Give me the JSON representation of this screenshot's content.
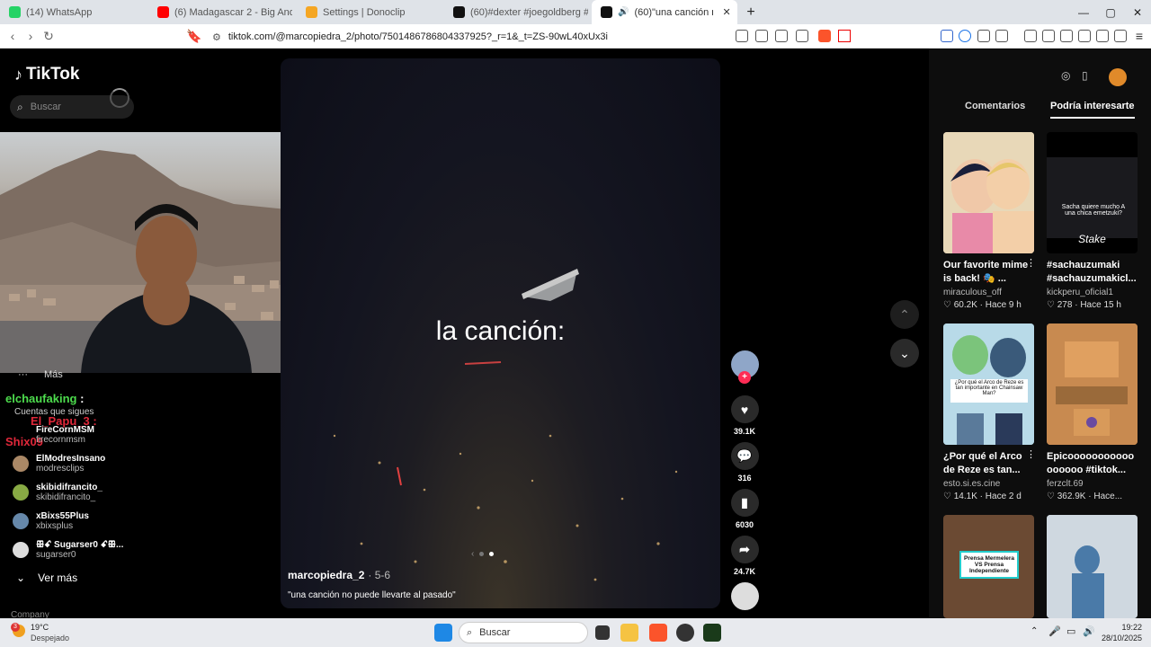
{
  "browser": {
    "tabs": [
      {
        "label": "(14) WhatsApp",
        "color": "#25d366"
      },
      {
        "label": "(6) Madagascar 2 - Big And Chunky",
        "color": "#ff0000"
      },
      {
        "label": "Settings | Donoclip",
        "color": "#f5a623"
      },
      {
        "label": "(60)#dexter #joegoldberg #paratiiii",
        "color": "#111111"
      },
      {
        "label": "(60)\"una canción no puede lle",
        "color": "#111111"
      }
    ],
    "url": "tiktok.com/@marcopiedra_2/photo/7501486786804337925?_r=1&_t=ZS-90wL40xUx3i"
  },
  "sidebar": {
    "logo": "TikTok",
    "search_placeholder": "Buscar",
    "more_label": "Más",
    "following_header": "Cuentas que sigues",
    "accounts": [
      {
        "name": "FireCornMSM",
        "handle": "firecornmsm",
        "color": "#c44"
      },
      {
        "name": "ElModresInsano",
        "handle": "modresclips",
        "color": "#aa8866"
      },
      {
        "name": "skibidifrancito_",
        "handle": "skibidifrancito_",
        "color": "#8a4"
      },
      {
        "name": "xBixs55Plus",
        "handle": "xbixsplus",
        "color": "#68a"
      },
      {
        "name": "ꕥꗃ Sugarser0 ꗃꕥ...",
        "handle": "sugarser0",
        "color": "#ddd"
      }
    ],
    "see_more": "Ver más",
    "company": "Company"
  },
  "chat_overlay": {
    "line1_user": "elchaufaking",
    "line1_sep": ":",
    "line2_user": "El_Papu_3",
    "line2_sep": ":",
    "line3_user": "Shix09"
  },
  "video": {
    "caption": "la canción:",
    "author": "marcopiedra_2",
    "date": "· 5-6",
    "description": "\"una canción no puede llevarte al pasado\""
  },
  "actions": {
    "likes": "39.1K",
    "comments": "316",
    "saves": "6030",
    "shares": "24.7K"
  },
  "right_panel": {
    "tabs": [
      "Comentarios",
      "Podría interesarte"
    ],
    "cards": [
      {
        "title": "Our favorite mime is back! 🎭 ...",
        "user": "miraculous_off",
        "likes": "60.2K",
        "time": "Hace 9 h",
        "bg": "#d9c3a6"
      },
      {
        "title": "#sachauzumaki #sachauzumakicl...",
        "user": "kickperu_oficial1",
        "likes": "278",
        "time": "Hace 15 h",
        "bg": "#1a1a1e",
        "overlay": "Sacha quiere mucho A una chica emetzuki?",
        "brand": "Stake"
      },
      {
        "title": "¿Por qué el Arco de Reze es tan...",
        "user": "esto.si.es.cine",
        "likes": "14.1K",
        "time": "Hace 2 d",
        "bg": "#9ac4d8",
        "overlay": "¿Por qué el Arco de Reze es tan importante en Chainsaw Man?"
      },
      {
        "title": "Epicooooooooooo oooooo #tiktok...",
        "user": "ferzclt.69",
        "likes": "362.9K",
        "time": "Hace...",
        "bg": "#c8874a"
      },
      {
        "title": "",
        "user": "",
        "likes": "",
        "time": "",
        "bg": "#6b4a33",
        "overlay": "Prensa Mermelera VS Prensa Independiente"
      },
      {
        "title": "",
        "user": "",
        "likes": "",
        "time": "",
        "bg": "#b9c8d8"
      }
    ]
  },
  "taskbar": {
    "temp": "19°C",
    "weather": "Despejado",
    "badge": "3",
    "search": "Buscar",
    "time": "19:22",
    "date": "28/10/2025"
  }
}
